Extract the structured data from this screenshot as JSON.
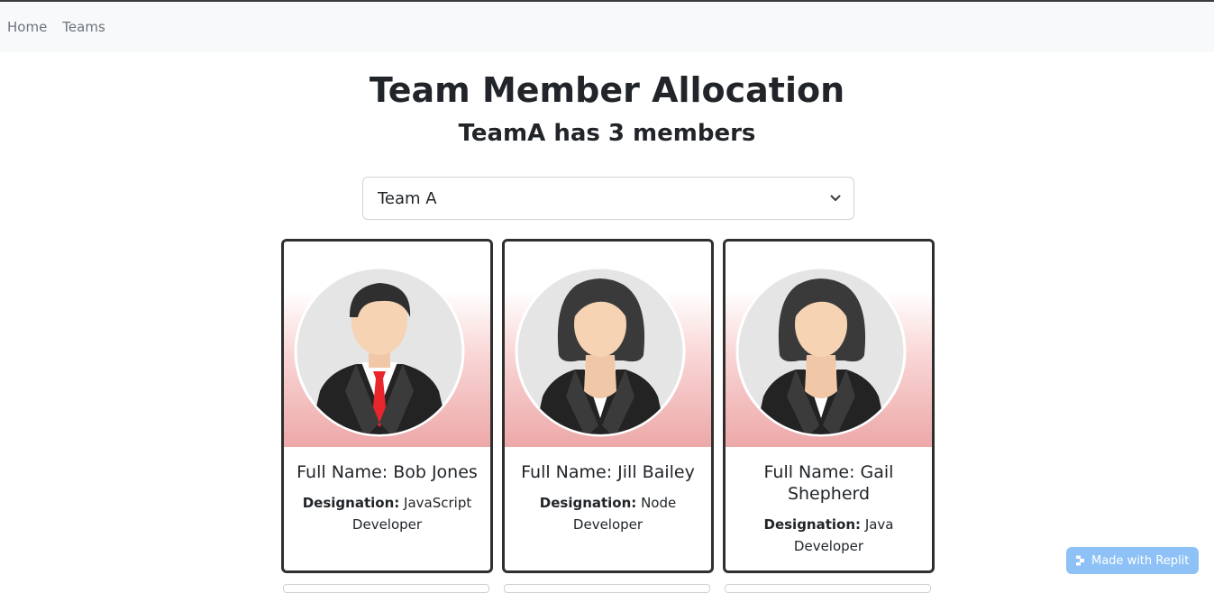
{
  "nav": {
    "home": "Home",
    "teams": "Teams"
  },
  "page": {
    "title": "Team Member Allocation",
    "subtitle": "TeamA has 3 members"
  },
  "team_select": {
    "selected": "Team A"
  },
  "cards": [
    {
      "full_name": "Full Name: Bob Jones",
      "designation_label": "Designation:",
      "designation": "JavaScript Developer",
      "avatar": "male-avatar"
    },
    {
      "full_name": "Full Name: Jill Bailey",
      "designation_label": "Designation:",
      "designation": "Node Developer",
      "avatar": "female-avatar"
    },
    {
      "full_name": "Full Name: Gail Shepherd",
      "designation_label": "Designation:",
      "designation": "Java Developer",
      "avatar": "female-avatar"
    }
  ],
  "badge": {
    "label": "Made with Replit",
    "icon": "replit-icon"
  },
  "colors": {
    "navbar_bg": "#f8f9fa",
    "card_border": "#2f2f2f",
    "gradient_bottom": "#eda8a8",
    "tie": "#e8262b",
    "badge_bg": "#8ec2f6"
  }
}
